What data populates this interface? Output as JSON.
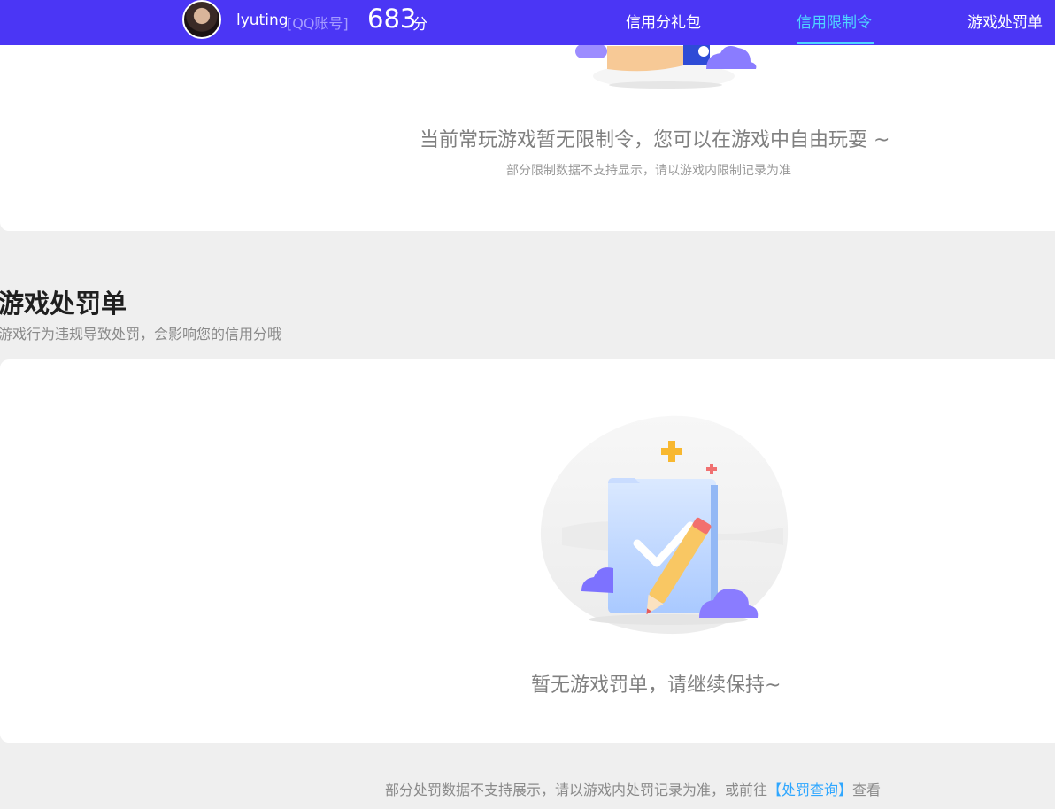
{
  "header": {
    "username": "lyuting",
    "account_type": "[QQ账号]",
    "score": "683",
    "score_unit": "分",
    "nav": [
      {
        "label": "信用分礼包",
        "active": false
      },
      {
        "label": "信用限制令",
        "active": true
      },
      {
        "label": "游戏处罚单",
        "active": false
      }
    ],
    "accent_color": "#4b36f5",
    "active_color": "#4fd4ff"
  },
  "restriction_card": {
    "message": "当前常玩游戏暂无限制令，您可以在游戏中自由玩耍 ~",
    "sub_message": "部分限制数据不支持显示，请以游戏内限制记录为准",
    "illustration_icon": "clipboard-cloud-icon"
  },
  "penalty_section": {
    "title": "游戏处罚单",
    "description": "游戏行为违规导致处罚，会影响您的信用分哦",
    "empty_message": "暂无游戏罚单，请继续保持~",
    "illustration_icon": "folder-pencil-check-icon"
  },
  "footer": {
    "note_prefix": "部分处罚数据不支持展示，请以游戏内处罚记录为准，或前往",
    "link_label": "【处罚查询】",
    "note_suffix": "查看"
  }
}
